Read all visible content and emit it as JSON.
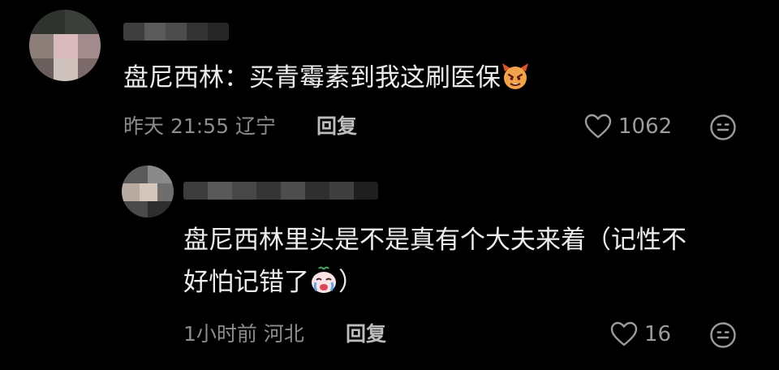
{
  "comments": [
    {
      "text": "盘尼西林：买青霉素到我这刷医保",
      "inline_emoji": "devil-emoji",
      "timestamp": "昨天 21:55",
      "location": "辽宁",
      "reply_label": "回复",
      "like_count": "1062"
    },
    {
      "text_line1": "盘尼西林里头是不是真有个大夫来着（记性不",
      "text_line2": "好怕记错了",
      "text_line2_tail": "）",
      "inline_emoji": "crying-emoji",
      "timestamp": "1小时前",
      "location": "河北",
      "reply_label": "回复",
      "like_count": "16"
    }
  ],
  "icons": {
    "like": "heart-outline-icon",
    "react": "smiley-face-icon"
  },
  "colors": {
    "background": "#000000",
    "text": "#ececec",
    "meta": "#8c8c8c",
    "reply": "#bdbdbd"
  }
}
